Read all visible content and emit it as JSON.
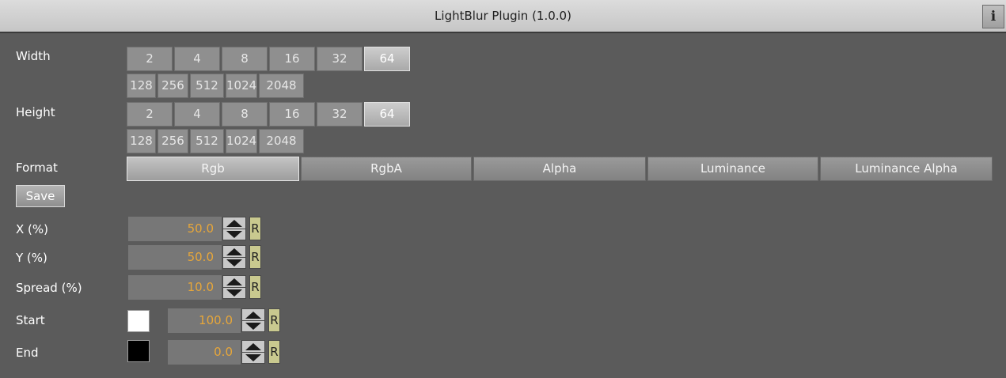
{
  "window": {
    "title": "LightBlur Plugin (1.0.0)",
    "info_label": "i"
  },
  "width": {
    "label": "Width",
    "row1": [
      "2",
      "4",
      "8",
      "16",
      "32",
      "64"
    ],
    "row2": [
      "128",
      "256",
      "512",
      "1024",
      "2048"
    ],
    "selected": "64"
  },
  "height": {
    "label": "Height",
    "row1": [
      "2",
      "4",
      "8",
      "16",
      "32",
      "64"
    ],
    "row2": [
      "128",
      "256",
      "512",
      "1024",
      "2048"
    ],
    "selected": "64"
  },
  "format": {
    "label": "Format",
    "options": [
      "Rgb",
      "RgbA",
      "Alpha",
      "Luminance",
      "Luminance Alpha"
    ],
    "selected": "Rgb"
  },
  "save_label": "Save",
  "params": {
    "x": {
      "label": "X (%)",
      "value": "50.0",
      "reset": "R"
    },
    "y": {
      "label": "Y (%)",
      "value": "50.0",
      "reset": "R"
    },
    "spread": {
      "label": "Spread (%)",
      "value": "10.0",
      "reset": "R"
    },
    "start": {
      "label": "Start",
      "value": "100.0",
      "reset": "R",
      "color": "#ffffff"
    },
    "end": {
      "label": "End",
      "value": "0.0",
      "reset": "R",
      "color": "#000000"
    }
  },
  "colors": {
    "value_text": "#e6a63a",
    "background": "#5b5b5b"
  }
}
